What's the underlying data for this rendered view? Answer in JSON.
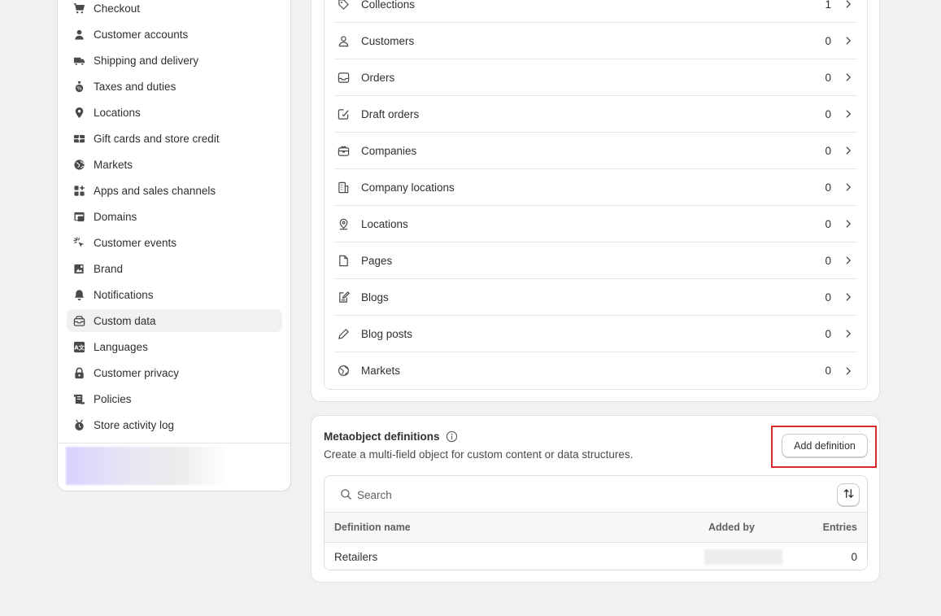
{
  "sidebar": {
    "items": [
      {
        "label": "Checkout",
        "icon": "cart-icon"
      },
      {
        "label": "Customer accounts",
        "icon": "person-icon"
      },
      {
        "label": "Shipping and delivery",
        "icon": "truck-icon"
      },
      {
        "label": "Taxes and duties",
        "icon": "tax-icon"
      },
      {
        "label": "Locations",
        "icon": "location-pin-icon"
      },
      {
        "label": "Gift cards and store credit",
        "icon": "gift-card-icon"
      },
      {
        "label": "Markets",
        "icon": "globe-icon"
      },
      {
        "label": "Apps and sales channels",
        "icon": "apps-icon"
      },
      {
        "label": "Domains",
        "icon": "domain-icon"
      },
      {
        "label": "Customer events",
        "icon": "cursor-click-icon"
      },
      {
        "label": "Brand",
        "icon": "brand-icon"
      },
      {
        "label": "Notifications",
        "icon": "bell-icon"
      },
      {
        "label": "Custom data",
        "icon": "custom-data-icon",
        "active": true
      },
      {
        "label": "Languages",
        "icon": "language-icon"
      },
      {
        "label": "Customer privacy",
        "icon": "lock-icon"
      },
      {
        "label": "Policies",
        "icon": "policy-icon"
      },
      {
        "label": "Store activity log",
        "icon": "activity-log-icon"
      }
    ]
  },
  "metafields": {
    "rows": [
      {
        "label": "Collections",
        "count": "1",
        "icon": "tag-icon"
      },
      {
        "label": "Customers",
        "count": "0",
        "icon": "person-outline-icon"
      },
      {
        "label": "Orders",
        "count": "0",
        "icon": "inbox-icon"
      },
      {
        "label": "Draft orders",
        "count": "0",
        "icon": "draft-order-icon"
      },
      {
        "label": "Companies",
        "count": "0",
        "icon": "briefcase-icon"
      },
      {
        "label": "Company locations",
        "count": "0",
        "icon": "building-icon"
      },
      {
        "label": "Locations",
        "count": "0",
        "icon": "location-outline-icon"
      },
      {
        "label": "Pages",
        "count": "0",
        "icon": "page-icon"
      },
      {
        "label": "Blogs",
        "count": "0",
        "icon": "blog-icon"
      },
      {
        "label": "Blog posts",
        "count": "0",
        "icon": "pencil-icon"
      },
      {
        "label": "Markets",
        "count": "0",
        "icon": "globe-outline-icon"
      }
    ]
  },
  "metaobjects": {
    "title": "Metaobject definitions",
    "subtitle": "Create a multi-field object for custom content or data structures.",
    "add_button": "Add definition",
    "search_placeholder": "Search",
    "columns": {
      "name": "Definition name",
      "added_by": "Added by",
      "entries": "Entries"
    },
    "rows": [
      {
        "name": "Retailers",
        "entries": "0"
      }
    ]
  },
  "colors": {
    "highlight": "#d72c2c",
    "active_bg": "#f1f1f1"
  }
}
